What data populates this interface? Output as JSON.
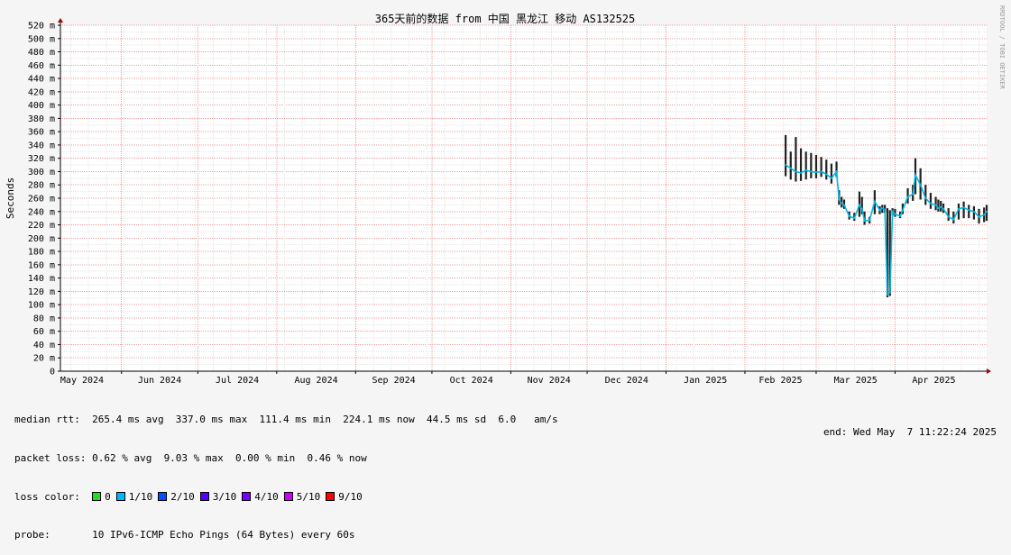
{
  "chart_data": {
    "type": "line",
    "title": "365天前的数据 from 中国 黑龙江 移动 AS132525",
    "ylabel": "Seconds",
    "xlabel": "",
    "ylim": [
      0,
      520
    ],
    "y_ticks": [
      {
        "value": 0,
        "label": "0"
      },
      {
        "value": 20,
        "label": "20 m"
      },
      {
        "value": 40,
        "label": "40 m"
      },
      {
        "value": 60,
        "label": "60 m"
      },
      {
        "value": 80,
        "label": "80 m"
      },
      {
        "value": 100,
        "label": "100 m"
      },
      {
        "value": 120,
        "label": "120 m"
      },
      {
        "value": 140,
        "label": "140 m"
      },
      {
        "value": 160,
        "label": "160 m"
      },
      {
        "value": 180,
        "label": "180 m"
      },
      {
        "value": 200,
        "label": "200 m"
      },
      {
        "value": 220,
        "label": "220 m"
      },
      {
        "value": 240,
        "label": "240 m"
      },
      {
        "value": 260,
        "label": "260 m"
      },
      {
        "value": 280,
        "label": "280 m"
      },
      {
        "value": 300,
        "label": "300 m"
      },
      {
        "value": 320,
        "label": "320 m"
      },
      {
        "value": 340,
        "label": "340 m"
      },
      {
        "value": 360,
        "label": "360 m"
      },
      {
        "value": 380,
        "label": "380 m"
      },
      {
        "value": 400,
        "label": "400 m"
      },
      {
        "value": 420,
        "label": "420 m"
      },
      {
        "value": 440,
        "label": "440 m"
      },
      {
        "value": 460,
        "label": "460 m"
      },
      {
        "value": 480,
        "label": "480 m"
      },
      {
        "value": 500,
        "label": "500 m"
      },
      {
        "value": 520,
        "label": "520 m"
      }
    ],
    "x_range": [
      "2024-05-08",
      "2025-05-07"
    ],
    "x_ticks": [
      {
        "date": "2024-05-01",
        "label": "May 2024"
      },
      {
        "date": "2024-06-01",
        "label": "Jun 2024"
      },
      {
        "date": "2024-07-01",
        "label": "Jul 2024"
      },
      {
        "date": "2024-08-01",
        "label": "Aug 2024"
      },
      {
        "date": "2024-09-01",
        "label": "Sep 2024"
      },
      {
        "date": "2024-10-01",
        "label": "Oct 2024"
      },
      {
        "date": "2024-11-01",
        "label": "Nov 2024"
      },
      {
        "date": "2024-12-01",
        "label": "Dec 2024"
      },
      {
        "date": "2025-01-01",
        "label": "Jan 2025"
      },
      {
        "date": "2025-02-01",
        "label": "Feb 2025"
      },
      {
        "date": "2025-03-01",
        "label": "Mar 2025"
      },
      {
        "date": "2025-04-01",
        "label": "Apr 2025"
      }
    ],
    "grid": true,
    "series": [
      {
        "x": [
          "2025-02-17",
          "2025-02-19",
          "2025-02-21",
          "2025-02-23",
          "2025-02-25",
          "2025-02-27",
          "2025-03-01",
          "2025-03-03",
          "2025-03-05",
          "2025-03-07",
          "2025-03-09",
          "2025-03-10",
          "2025-03-11",
          "2025-03-12",
          "2025-03-14",
          "2025-03-16",
          "2025-03-18",
          "2025-03-19",
          "2025-03-20",
          "2025-03-22",
          "2025-03-24",
          "2025-03-26",
          "2025-03-27",
          "2025-03-28",
          "2025-03-29",
          "2025-03-30",
          "2025-03-31",
          "2025-04-01",
          "2025-04-03",
          "2025-04-04",
          "2025-04-06",
          "2025-04-08",
          "2025-04-09",
          "2025-04-11",
          "2025-04-13",
          "2025-04-15",
          "2025-04-17",
          "2025-04-18",
          "2025-04-19",
          "2025-04-20",
          "2025-04-22",
          "2025-04-24",
          "2025-04-26",
          "2025-04-28",
          "2025-04-30",
          "2025-05-02",
          "2025-05-04",
          "2025-05-06",
          "2025-05-07"
        ],
        "values": [
          310,
          305,
          300,
          298,
          302,
          300,
          299,
          300,
          296,
          290,
          300,
          258,
          252,
          250,
          233,
          230,
          250,
          244,
          226,
          227,
          255,
          242,
          245,
          243,
          115,
          118,
          240,
          236,
          233,
          242,
          262,
          266,
          295,
          280,
          260,
          252,
          250,
          245,
          247,
          244,
          232,
          228,
          244,
          246,
          242,
          240,
          232,
          235,
          240
        ],
        "min": [
          293,
          288,
          285,
          286,
          288,
          290,
          290,
          292,
          288,
          282,
          292,
          250,
          246,
          244,
          228,
          226,
          232,
          236,
          220,
          222,
          236,
          236,
          238,
          238,
          111,
          113,
          234,
          232,
          230,
          236,
          252,
          256,
          266,
          258,
          250,
          244,
          242,
          240,
          240,
          238,
          226,
          222,
          228,
          230,
          230,
          228,
          222,
          224,
          226
        ],
        "max": [
          355,
          330,
          352,
          335,
          330,
          328,
          325,
          322,
          318,
          312,
          315,
          272,
          262,
          258,
          240,
          238,
          270,
          262,
          240,
          232,
          272,
          248,
          250,
          250,
          245,
          242,
          245,
          244,
          240,
          252,
          275,
          280,
          320,
          305,
          280,
          268,
          262,
          258,
          256,
          252,
          245,
          240,
          252,
          255,
          250,
          248,
          244,
          246,
          250
        ],
        "color": "#00b8e0"
      }
    ],
    "loss_colors": [
      "#22dd22",
      "#00b8ff",
      "#0050ff",
      "#5500ff",
      "#7a00ff",
      "#cc00ff",
      "#ff0000"
    ]
  },
  "watermark": "RRDTOOL / TOBI OETIKER",
  "stats": {
    "median_rtt": "median rtt:  265.4 ms avg  337.0 ms max  111.4 ms min  224.1 ms now  44.5 ms sd  6.0   am/s",
    "packet_loss": "packet loss: 0.62 % avg  9.03 % max  0.00 % min  0.46 % now",
    "loss_color_label": "loss color:",
    "loss_items": [
      {
        "label": "0",
        "color": "#22dd22"
      },
      {
        "label": "1/10",
        "color": "#00b8ff"
      },
      {
        "label": "2/10",
        "color": "#0050ff"
      },
      {
        "label": "3/10",
        "color": "#5500ff"
      },
      {
        "label": "4/10",
        "color": "#7a00ff"
      },
      {
        "label": "5/10",
        "color": "#cc00ff"
      },
      {
        "label": "9/10",
        "color": "#ff0000"
      }
    ],
    "probe": "probe:       10 IPv6-ICMP Echo Pings (64 Bytes) every 60s",
    "end": "end: Wed May  7 11:22:24 2025"
  }
}
